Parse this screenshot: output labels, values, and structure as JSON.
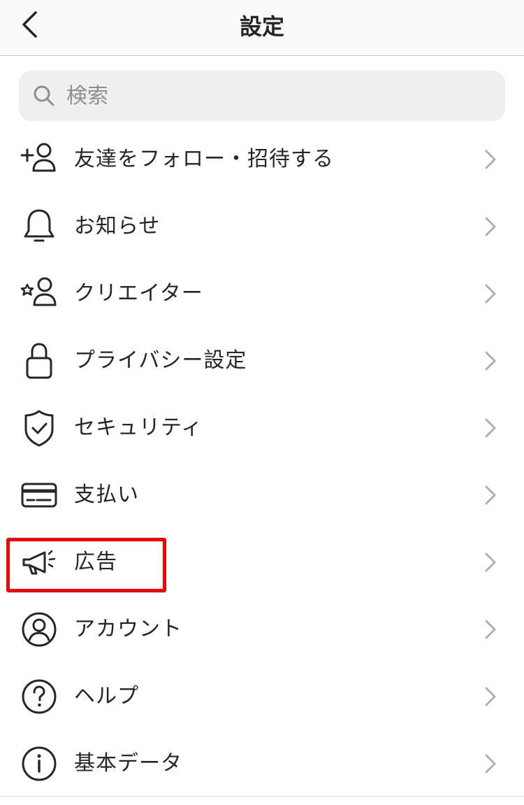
{
  "header": {
    "title": "設定",
    "back_icon": "chevron-left-icon"
  },
  "search": {
    "placeholder": "検索",
    "icon": "search-icon"
  },
  "menu": {
    "items": [
      {
        "label": "友達をフォロー・招待する",
        "icon": "add-user-icon"
      },
      {
        "label": "お知らせ",
        "icon": "bell-icon"
      },
      {
        "label": "クリエイター",
        "icon": "creator-star-user-icon"
      },
      {
        "label": "プライバシー設定",
        "icon": "lock-icon"
      },
      {
        "label": "セキュリティ",
        "icon": "shield-check-icon"
      },
      {
        "label": "支払い",
        "icon": "credit-card-icon"
      },
      {
        "label": "広告",
        "icon": "megaphone-icon"
      },
      {
        "label": "アカウント",
        "icon": "account-circle-icon"
      },
      {
        "label": "ヘルプ",
        "icon": "help-circle-icon"
      },
      {
        "label": "基本データ",
        "icon": "info-circle-icon"
      }
    ]
  },
  "highlight": {
    "target": "広告",
    "color": "#ff0000"
  }
}
